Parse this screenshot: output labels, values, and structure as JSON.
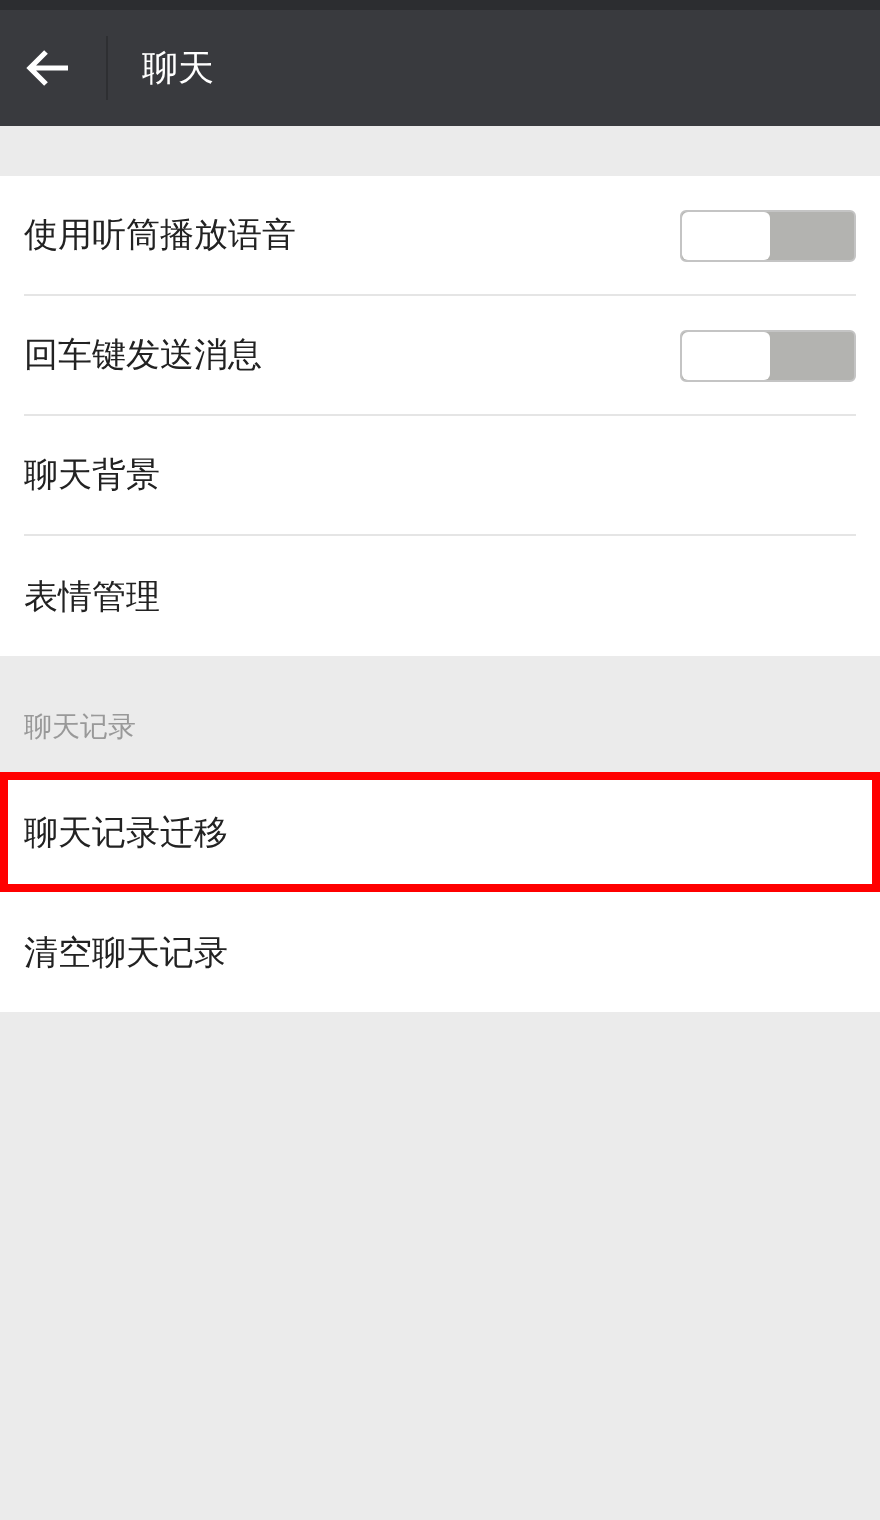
{
  "header": {
    "title": "聊天"
  },
  "groups": [
    {
      "items": [
        {
          "kind": "toggle",
          "label": "使用听筒播放语音",
          "on": false,
          "highlighted": false
        },
        {
          "kind": "toggle",
          "label": "回车键发送消息",
          "on": false,
          "highlighted": false
        },
        {
          "kind": "link",
          "label": "聊天背景",
          "highlighted": false
        },
        {
          "kind": "link",
          "label": "表情管理",
          "highlighted": false
        }
      ]
    },
    {
      "title": "聊天记录",
      "items": [
        {
          "kind": "link",
          "label": "聊天记录迁移",
          "highlighted": true
        },
        {
          "kind": "link",
          "label": "清空聊天记录",
          "highlighted": false
        }
      ]
    }
  ]
}
